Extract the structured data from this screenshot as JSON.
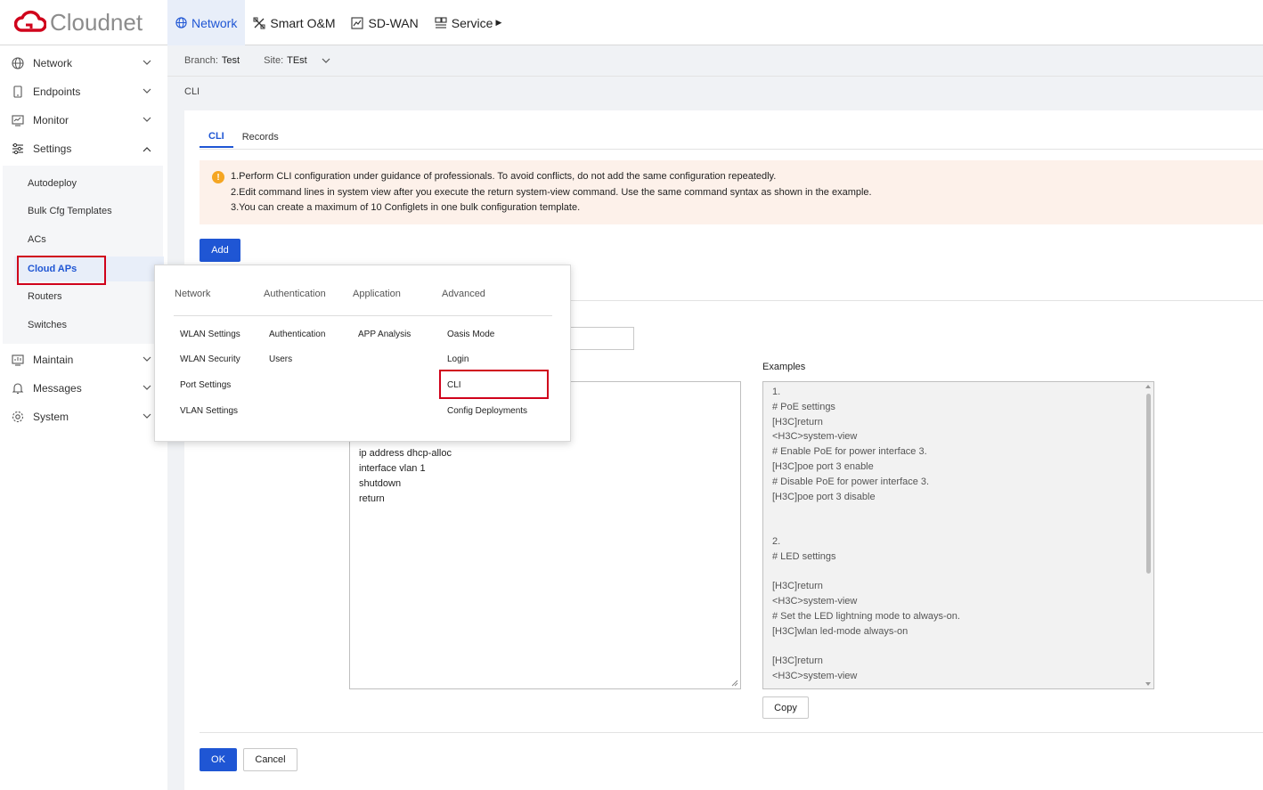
{
  "app": {
    "logo_text": "Cloudnet"
  },
  "topnav": [
    {
      "label": "Network",
      "icon": "globe-icon",
      "active": true
    },
    {
      "label": "Smart O&M",
      "icon": "tools-icon"
    },
    {
      "label": "SD-WAN",
      "icon": "chart-icon"
    },
    {
      "label": "Service",
      "icon": "service-icon"
    }
  ],
  "sidebar": {
    "items": [
      {
        "label": "Network",
        "icon": "globe-icon"
      },
      {
        "label": "Endpoints",
        "icon": "device-icon"
      },
      {
        "label": "Monitor",
        "icon": "monitor-icon"
      },
      {
        "label": "Settings",
        "icon": "sliders-icon",
        "expanded": true
      },
      {
        "label": "Maintain",
        "icon": "maintain-icon"
      },
      {
        "label": "Messages",
        "icon": "bell-icon"
      },
      {
        "label": "System",
        "icon": "gear-icon"
      }
    ],
    "settings_sub": [
      "Autodeploy",
      "Bulk Cfg Templates",
      "ACs",
      "Cloud APs",
      "Routers",
      "Switches"
    ],
    "active_sub": "Cloud APs"
  },
  "breadcrumb": {
    "branch_label": "Branch:",
    "branch_value": "Test",
    "site_label": "Site:",
    "site_value": "TEst"
  },
  "page": {
    "title": "CLI"
  },
  "tabs": [
    "CLI",
    "Records"
  ],
  "notice": [
    "1.Perform CLI configuration under guidance of professionals. To avoid conflicts, do not add the same configuration repeatedly.",
    "2.Edit command lines in system view after you execute the return system-view command. Use the same command syntax as shown in the example.",
    "3.You can create a maximum of 10 Configlets in one bulk configuration template."
  ],
  "buttons": {
    "add": "Add",
    "copy": "Copy",
    "ok": "OK",
    "cancel": "Cancel"
  },
  "examples_label": "Examples",
  "commands": [
    "ip address dhcp-alloc",
    "interface vlan 1",
    "shutdown",
    "return"
  ],
  "examples": [
    "1.",
    "# PoE settings",
    "[H3C]return",
    "<H3C>system-view",
    "# Enable PoE for power interface 3.",
    "[H3C]poe port 3 enable",
    "# Disable PoE for power interface 3.",
    "[H3C]poe port 3 disable",
    "",
    "",
    "2.",
    "# LED settings",
    "",
    "[H3C]return",
    "<H3C>system-view",
    "# Set the LED lightning mode to always-on.",
    "[H3C]wlan led-mode always-on",
    "",
    "[H3C]return",
    "<H3C>system-view"
  ],
  "dropdown": {
    "columns": [
      {
        "header": "Network",
        "items": [
          "WLAN Settings",
          "WLAN Security",
          "Port Settings",
          "VLAN Settings"
        ]
      },
      {
        "header": "Authentication",
        "items": [
          "Authentication",
          "Users"
        ]
      },
      {
        "header": "Application",
        "items": [
          "APP Analysis"
        ]
      },
      {
        "header": "Advanced",
        "items": [
          "Oasis Mode",
          "Login",
          "CLI",
          "Config Deployments"
        ]
      }
    ]
  },
  "colors": {
    "primary": "#1f56d4",
    "highlight": "#d0021b",
    "brand": "#d0021b"
  }
}
